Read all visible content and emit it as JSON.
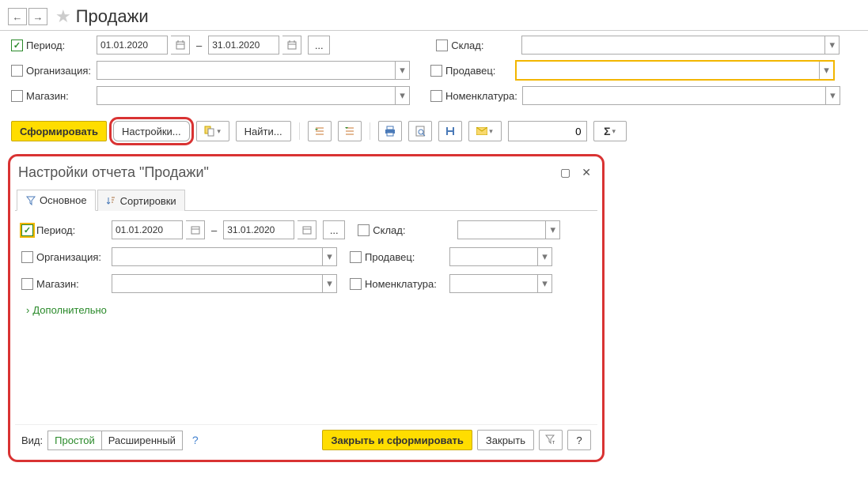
{
  "header": {
    "title": "Продажи"
  },
  "filters": {
    "period_label": "Период:",
    "period_from": "01.01.2020",
    "period_to": "31.01.2020",
    "org_label": "Организация:",
    "store_label": "Магазин:",
    "warehouse_label": "Склад:",
    "seller_label": "Продавец:",
    "sku_label": "Номенклатура:",
    "more": "..."
  },
  "toolbar": {
    "generate": "Сформировать",
    "settings": "Настройки...",
    "find": "Найти...",
    "num": "0"
  },
  "modal": {
    "title": "Настройки отчета \"Продажи\"",
    "tabs": {
      "main": "Основное",
      "sort": "Сортировки"
    },
    "expand": "Дополнительно",
    "view_label": "Вид:",
    "view_simple": "Простой",
    "view_ext": "Расширенный",
    "close_generate": "Закрыть и сформировать",
    "close": "Закрыть",
    "help": "?"
  }
}
